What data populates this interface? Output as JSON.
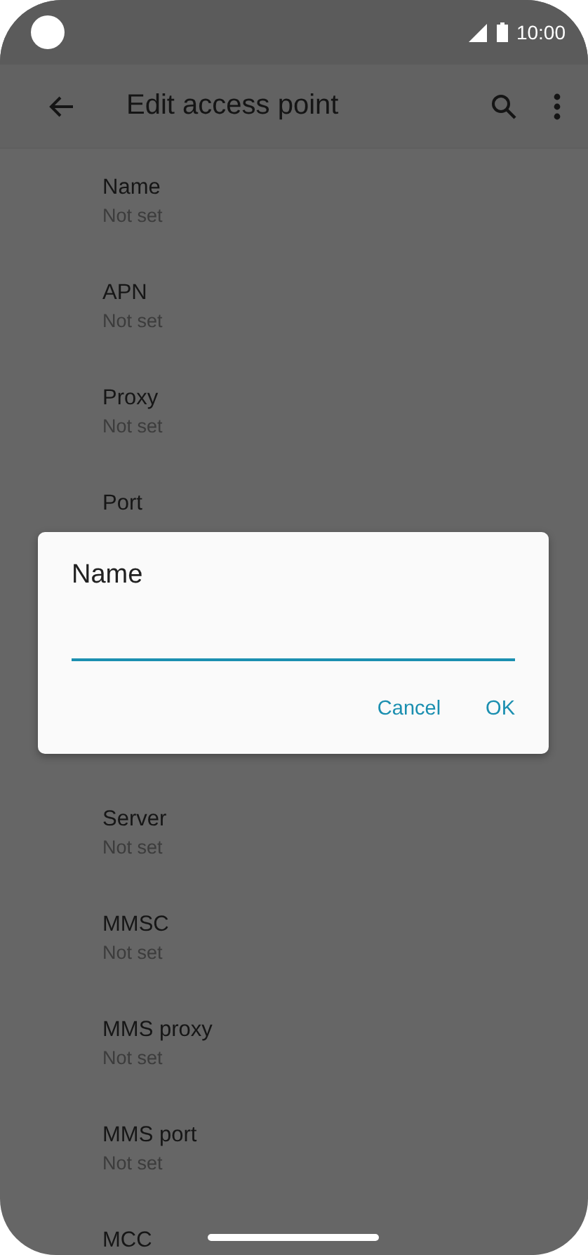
{
  "status_bar": {
    "time": "10:00"
  },
  "app_bar": {
    "title": "Edit access point"
  },
  "settings_above": [
    {
      "label": "Name",
      "value": "Not set"
    },
    {
      "label": "APN",
      "value": "Not set"
    },
    {
      "label": "Proxy",
      "value": "Not set"
    },
    {
      "label": "Port"
    }
  ],
  "settings_below": [
    {
      "label": "Server",
      "value": "Not set"
    },
    {
      "label": "MMSC",
      "value": "Not set"
    },
    {
      "label": "MMS proxy",
      "value": "Not set"
    },
    {
      "label": "MMS port",
      "value": "Not set"
    },
    {
      "label": "MCC"
    }
  ],
  "dialog": {
    "title": "Name",
    "buttons": [
      "Cancel",
      "OK"
    ]
  }
}
